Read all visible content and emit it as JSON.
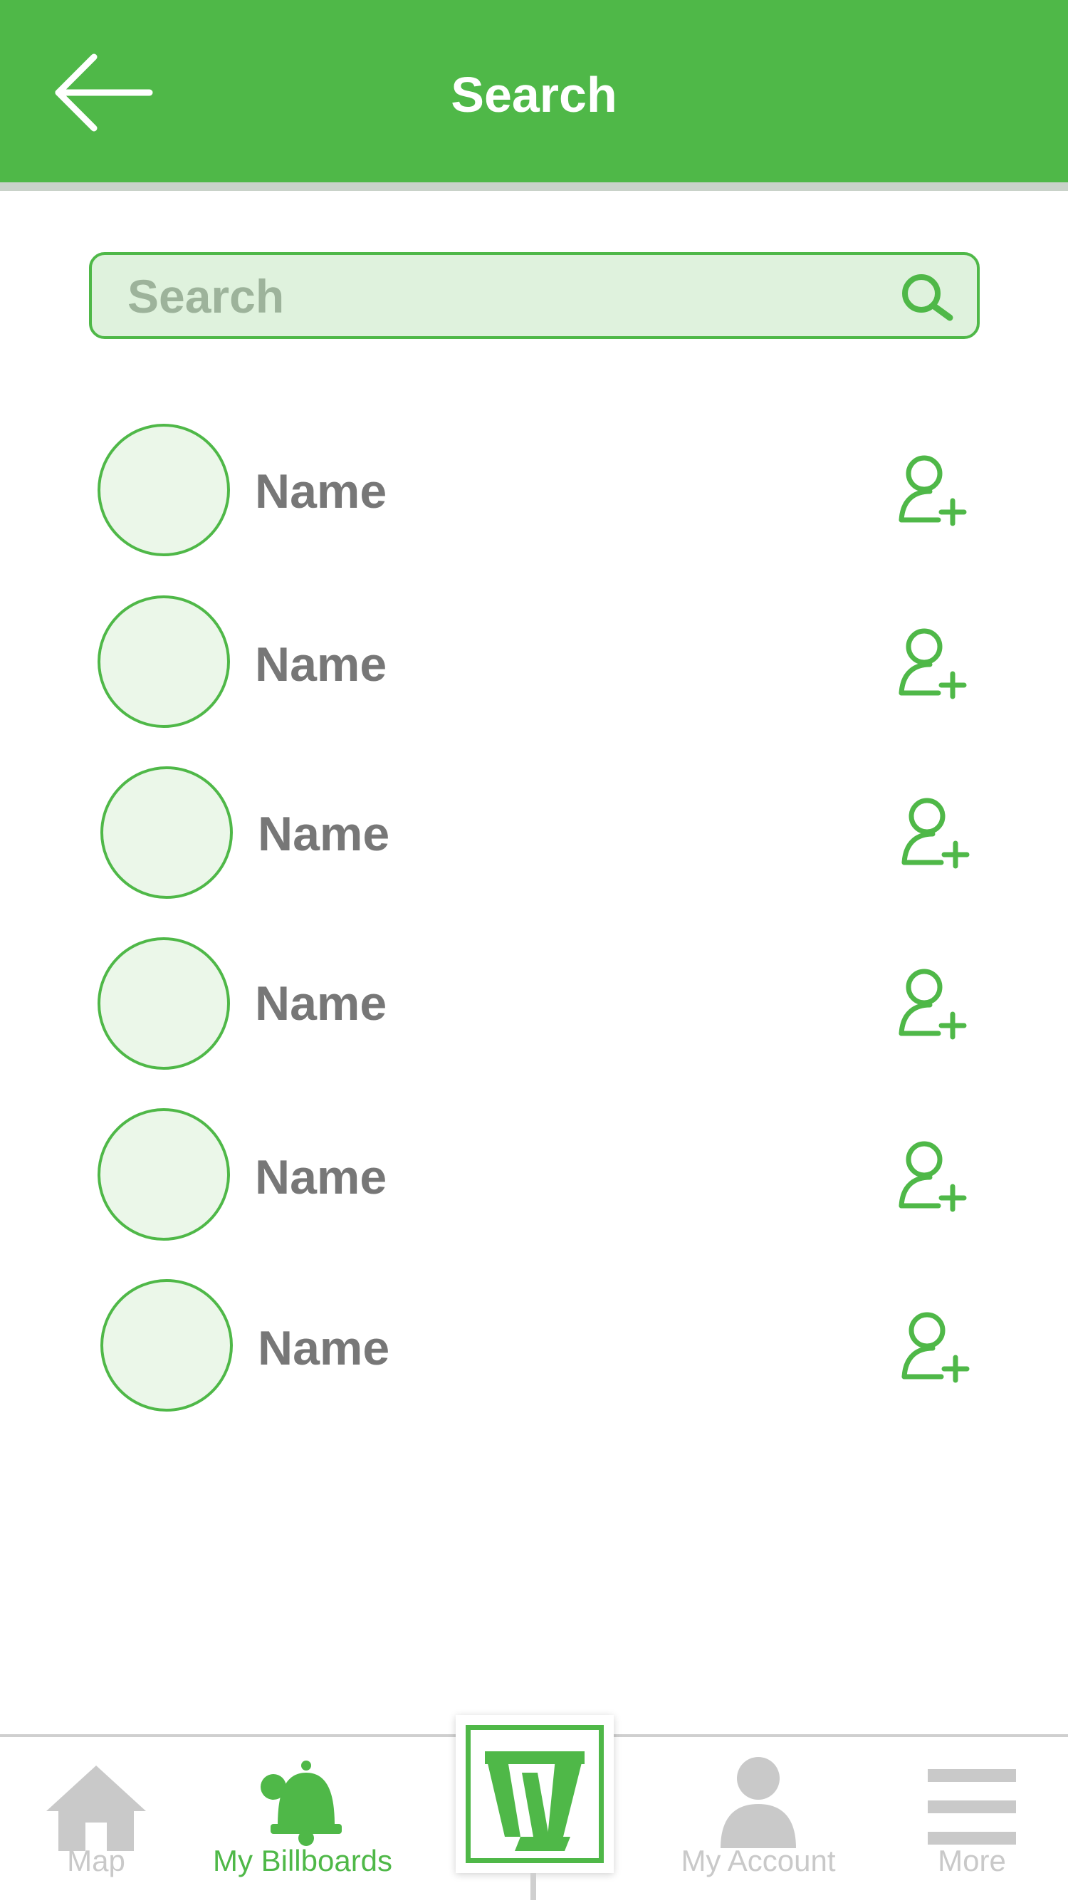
{
  "header": {
    "title": "Search",
    "back_icon": "arrow-left-icon",
    "background_color": "#4fb848"
  },
  "search": {
    "placeholder": "Search",
    "value": "",
    "icon": "search-icon"
  },
  "results": [
    {
      "name": "Name",
      "action_icon": "add-user-icon"
    },
    {
      "name": "Name",
      "action_icon": "add-user-icon"
    },
    {
      "name": "Name",
      "action_icon": "add-user-icon"
    },
    {
      "name": "Name",
      "action_icon": "add-user-icon"
    },
    {
      "name": "Name",
      "action_icon": "add-user-icon"
    },
    {
      "name": "Name",
      "action_icon": "add-user-icon"
    }
  ],
  "bottom_nav": {
    "items": [
      {
        "label": "Map",
        "icon": "home-icon",
        "active": false
      },
      {
        "label": "My Billboards",
        "icon": "bell-icon",
        "active": true
      },
      {
        "label": "",
        "icon": "w-logo-icon",
        "active": false
      },
      {
        "label": "My Account",
        "icon": "user-icon",
        "active": false
      },
      {
        "label": "More",
        "icon": "menu-icon",
        "active": false
      }
    ]
  },
  "colors": {
    "accent": "#4fb848",
    "inactive": "#c9c9c9",
    "text": "#777777"
  }
}
